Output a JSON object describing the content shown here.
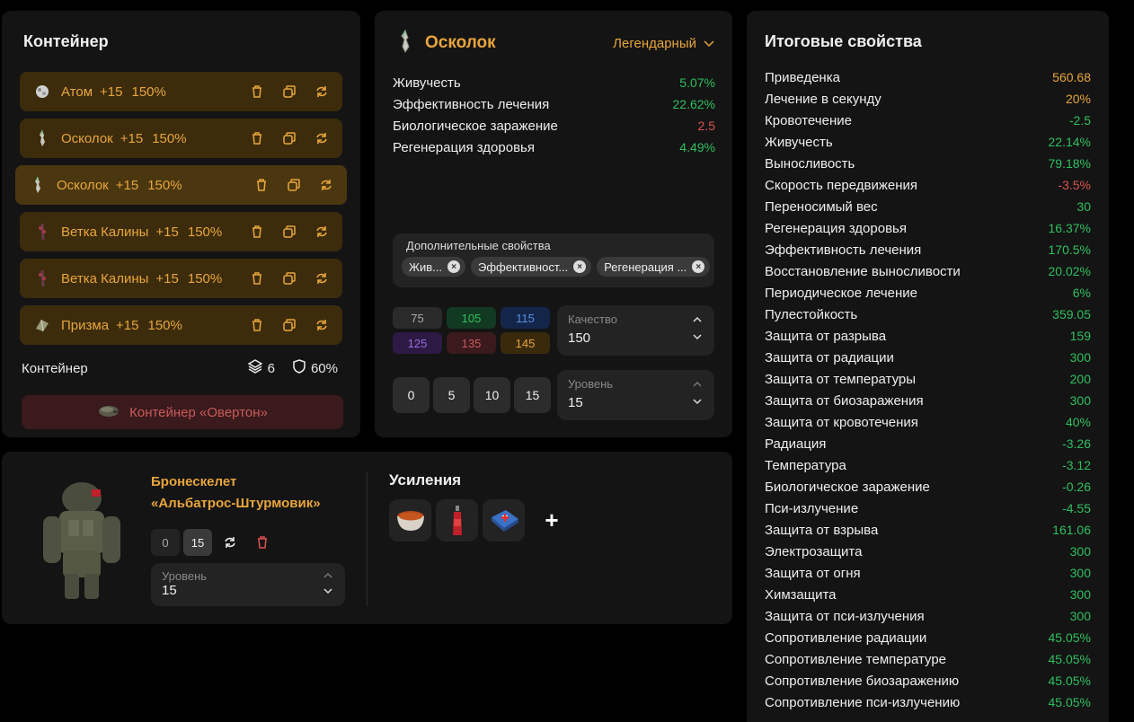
{
  "container": {
    "title": "Контейнер",
    "artifacts": [
      {
        "name": "Атом",
        "plus": "+15",
        "quality": "150%",
        "icon": "atom-artifact-icon"
      },
      {
        "name": "Осколок",
        "plus": "+15",
        "quality": "150%",
        "icon": "shard-artifact-icon"
      },
      {
        "name": "Осколок",
        "plus": "+15",
        "quality": "150%",
        "icon": "shard-artifact-icon"
      },
      {
        "name": "Ветка Калины",
        "plus": "+15",
        "quality": "150%",
        "icon": "viburnum-branch-icon"
      },
      {
        "name": "Ветка Калины",
        "plus": "+15",
        "quality": "150%",
        "icon": "viburnum-branch-icon"
      },
      {
        "name": "Призма",
        "plus": "+15",
        "quality": "150%",
        "icon": "prism-artifact-icon"
      }
    ],
    "footer_label": "Контейнер",
    "slots": "6",
    "protection": "60%",
    "container_button": "Контейнер «Овертон»",
    "colors": {
      "artifact_row_bg": "#3c2c0c",
      "artifact_text": "#e8a53d",
      "container_btn_bg": "#3a1a1c",
      "container_btn_text": "#c95a5a"
    }
  },
  "artifact": {
    "title": "Осколок",
    "rarity": "Легендарный",
    "properties": [
      {
        "name": "Живучесть",
        "value": "5.07%",
        "tone": "green"
      },
      {
        "name": "Эффективность лечения",
        "value": "22.62%",
        "tone": "green"
      },
      {
        "name": "Биологическое заражение",
        "value": "2.5",
        "tone": "red"
      },
      {
        "name": "Регенерация здоровья",
        "value": "4.49%",
        "tone": "green"
      }
    ],
    "extra_title": "Дополнительные свойства",
    "extra_chips": [
      "Жив...",
      "Эффективност...",
      "Регенерация ..."
    ],
    "quality_presets": [
      {
        "value": "75",
        "bg": "#2a2a2a",
        "fg": "#aaaaaa"
      },
      {
        "value": "105",
        "bg": "#123a22",
        "fg": "#2fbf5f"
      },
      {
        "value": "115",
        "bg": "#13264a",
        "fg": "#5b8de0"
      },
      {
        "value": "125",
        "bg": "#2c1a45",
        "fg": "#9a6ad8"
      },
      {
        "value": "135",
        "bg": "#3a1a1c",
        "fg": "#c95a5a"
      },
      {
        "value": "145",
        "bg": "#3a2a0c",
        "fg": "#e8a53d"
      }
    ],
    "quality_label": "Качество",
    "quality_value": "150",
    "level_presets": [
      "0",
      "5",
      "10",
      "15"
    ],
    "level_label": "Уровень",
    "level_value": "15"
  },
  "armor": {
    "name_line1": "Бронескелет",
    "name_line2": "«Альбатрос-Штурмовик»",
    "level_buttons": [
      "0",
      "15"
    ],
    "level_label": "Уровень",
    "level_value": "15",
    "boosts_title": "Усиления",
    "boosts": [
      "stew-bowl-icon",
      "energy-drink-bottle-icon",
      "medkit-icon"
    ]
  },
  "totals": {
    "title": "Итоговые свойства",
    "rows": [
      {
        "name": "Приведенка",
        "value": "560.68",
        "tone": "orange"
      },
      {
        "name": "Лечение в секунду",
        "value": "20%",
        "tone": "orange"
      },
      {
        "name": "Кровотечение",
        "value": "-2.5",
        "tone": "green"
      },
      {
        "name": "Живучесть",
        "value": "22.14%",
        "tone": "green"
      },
      {
        "name": "Выносливость",
        "value": "79.18%",
        "tone": "green"
      },
      {
        "name": "Скорость передвижения",
        "value": "-3.5%",
        "tone": "red"
      },
      {
        "name": "Переносимый вес",
        "value": "30",
        "tone": "green"
      },
      {
        "name": "Регенерация здоровья",
        "value": "16.37%",
        "tone": "green"
      },
      {
        "name": "Эффективность лечения",
        "value": "170.5%",
        "tone": "green"
      },
      {
        "name": "Восстановление выносливости",
        "value": "20.02%",
        "tone": "green"
      },
      {
        "name": "Периодическое лечение",
        "value": "6%",
        "tone": "green"
      },
      {
        "name": "Пулестойкость",
        "value": "359.05",
        "tone": "green"
      },
      {
        "name": "Защита от разрыва",
        "value": "159",
        "tone": "green"
      },
      {
        "name": "Защита от радиации",
        "value": "300",
        "tone": "green"
      },
      {
        "name": "Защита от температуры",
        "value": "200",
        "tone": "green"
      },
      {
        "name": "Защита от биозаражения",
        "value": "300",
        "tone": "green"
      },
      {
        "name": "Защита от кровотечения",
        "value": "40%",
        "tone": "green"
      },
      {
        "name": "Радиация",
        "value": "-3.26",
        "tone": "green"
      },
      {
        "name": "Температура",
        "value": "-3.12",
        "tone": "green"
      },
      {
        "name": "Биологическое заражение",
        "value": "-0.26",
        "tone": "green"
      },
      {
        "name": "Пси-излучение",
        "value": "-4.55",
        "tone": "green"
      },
      {
        "name": "Защита от взрыва",
        "value": "161.06",
        "tone": "green"
      },
      {
        "name": "Электрозащита",
        "value": "300",
        "tone": "green"
      },
      {
        "name": "Защита от огня",
        "value": "300",
        "tone": "green"
      },
      {
        "name": "Химзащита",
        "value": "300",
        "tone": "green"
      },
      {
        "name": "Защита от пси-излучения",
        "value": "300",
        "tone": "green"
      },
      {
        "name": "Сопротивление радиации",
        "value": "45.05%",
        "tone": "green"
      },
      {
        "name": "Сопротивление температуре",
        "value": "45.05%",
        "tone": "green"
      },
      {
        "name": "Сопротивление биозаражению",
        "value": "45.05%",
        "tone": "green"
      },
      {
        "name": "Сопротивление пси-излучению",
        "value": "45.05%",
        "tone": "green"
      }
    ]
  }
}
